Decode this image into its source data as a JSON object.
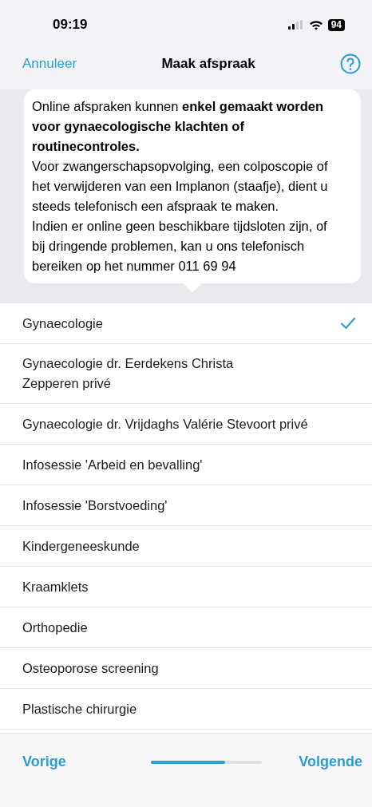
{
  "status_bar": {
    "time": "09:19",
    "battery": "94"
  },
  "nav": {
    "cancel": "Annuleer",
    "title": "Maak afspraak"
  },
  "popover": {
    "paragraphs": [
      "Online afspraken kunnen **enkel gemaakt worden voor gynaecologische klachten of routinecontroles.**",
      "Voor zwangerschapsopvolging, een colposcopie of het verwijderen van een Implanon (staafje), dient u steeds telefonisch een afspraak te maken.",
      "Indien er online geen beschikbare tijdsloten zijn, of bij dringende problemen, kan u ons telefonisch bereiken op het nummer 011 69 94"
    ]
  },
  "list": [
    {
      "label": "Gynaecologie",
      "selected": true
    },
    {
      "label": "Gynaecologie dr. Eerdekens Christa\nZepperen privé",
      "selected": false
    },
    {
      "label": "Gynaecologie dr. Vrijdaghs Valérie Stevoort privé",
      "selected": false
    },
    {
      "label": "Infosessie 'Arbeid en bevalling'",
      "selected": false
    },
    {
      "label": "Infosessie 'Borstvoeding'",
      "selected": false
    },
    {
      "label": "Kindergeneeskunde",
      "selected": false
    },
    {
      "label": "Kraamklets",
      "selected": false
    },
    {
      "label": "Orthopedie",
      "selected": false
    },
    {
      "label": "Osteoporose screening",
      "selected": false
    },
    {
      "label": "Plastische chirurgie",
      "selected": false
    }
  ],
  "footer": {
    "previous": "Vorige",
    "next": "Volgende",
    "progress": {
      "level": 0.67
    }
  }
}
